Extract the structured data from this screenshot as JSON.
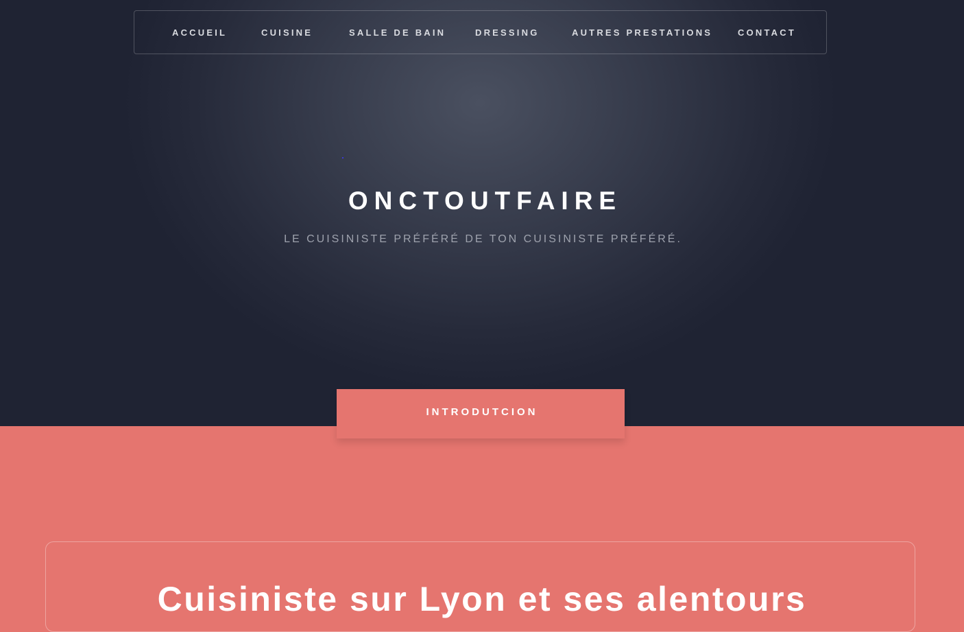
{
  "nav": {
    "items": [
      {
        "label": "ACCUEIL"
      },
      {
        "label": "CUISINE"
      },
      {
        "label": "SALLE DE BAIN"
      },
      {
        "label": "DRESSING"
      },
      {
        "label": "AUTRES PRESTATIONS"
      },
      {
        "label": "CONTACT"
      }
    ]
  },
  "hero": {
    "title": "ONCTOUTFAIRE",
    "tagline": "LE CUISINISTE PRÉFÉRÉ DE TON CUISINISTE PRÉFÉRÉ."
  },
  "intro": {
    "tab_label": "INTRODUTCION",
    "heading": "Cuisiniste sur Lyon et ses alentours"
  },
  "colors": {
    "hero_bg": "#262a3a",
    "accent": "#e5756f",
    "text_light": "#ffffff",
    "tagline": "#9ea2ad"
  }
}
